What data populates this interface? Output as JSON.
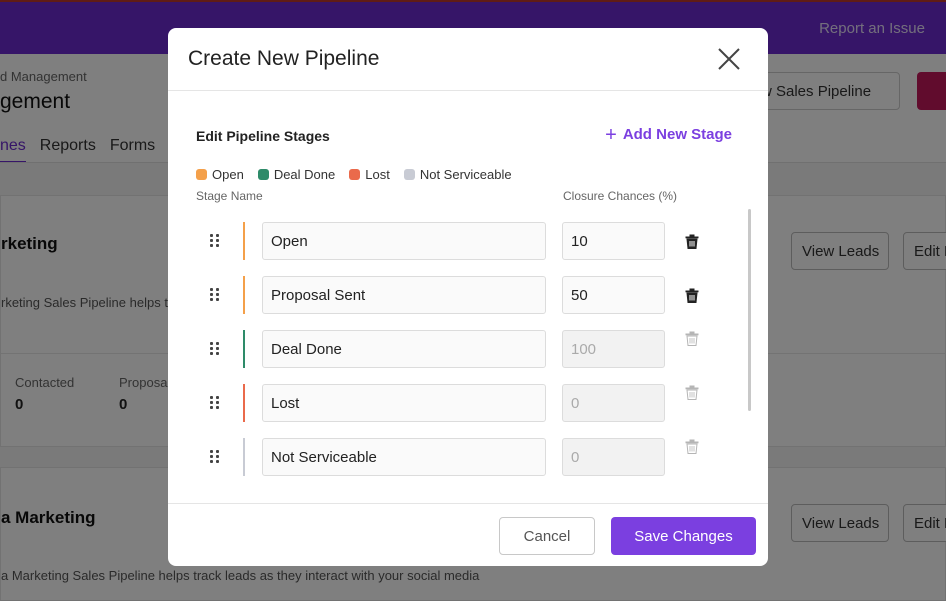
{
  "topbar": {
    "report_link": "Report an Issue"
  },
  "page": {
    "breadcrumb": "d Management",
    "title": "gement",
    "tabs": [
      {
        "label": "nes",
        "active": true
      },
      {
        "label": "Reports",
        "active": false
      },
      {
        "label": "Forms",
        "active": false
      }
    ],
    "new_pipeline_button": "w Sales Pipeline"
  },
  "cards": [
    {
      "name": "rketing",
      "description": "rketing Sales Pipeline helps tra",
      "view_leads": "View Leads",
      "edit": "Edit P",
      "stats": [
        {
          "label": "Contacted",
          "value": "0"
        },
        {
          "label": "Proposal",
          "value": "0"
        }
      ]
    },
    {
      "name": "a Marketing",
      "description": "a Marketing Sales Pipeline helps track leads as they interact with your social media",
      "view_leads": "View Leads",
      "edit": "Edit P"
    }
  ],
  "modal": {
    "title": "Create New Pipeline",
    "section_title": "Edit Pipeline Stages",
    "add_stage_label": "Add New Stage",
    "legend": [
      {
        "label": "Open",
        "color": "#f4a04a"
      },
      {
        "label": "Deal Done",
        "color": "#2e8b69"
      },
      {
        "label": "Lost",
        "color": "#ea6a4b"
      },
      {
        "label": "Not Serviceable",
        "color": "#c8cbd4"
      }
    ],
    "col_stage_name": "Stage Name",
    "col_closure": "Closure Chances (%)",
    "stages": [
      {
        "name": "Open",
        "chance": "10",
        "color": "#f4a04a",
        "editable": true
      },
      {
        "name": "Proposal Sent",
        "chance": "50",
        "color": "#f4a04a",
        "editable": true
      },
      {
        "name": "Deal Done",
        "chance": "100",
        "color": "#2e8b69",
        "editable": false
      },
      {
        "name": "Lost",
        "chance": "0",
        "color": "#ea6a4b",
        "editable": false
      },
      {
        "name": "Not Serviceable",
        "chance": "0",
        "color": "#c8cbd4",
        "editable": false
      }
    ],
    "cancel_label": "Cancel",
    "save_label": "Save Changes"
  }
}
